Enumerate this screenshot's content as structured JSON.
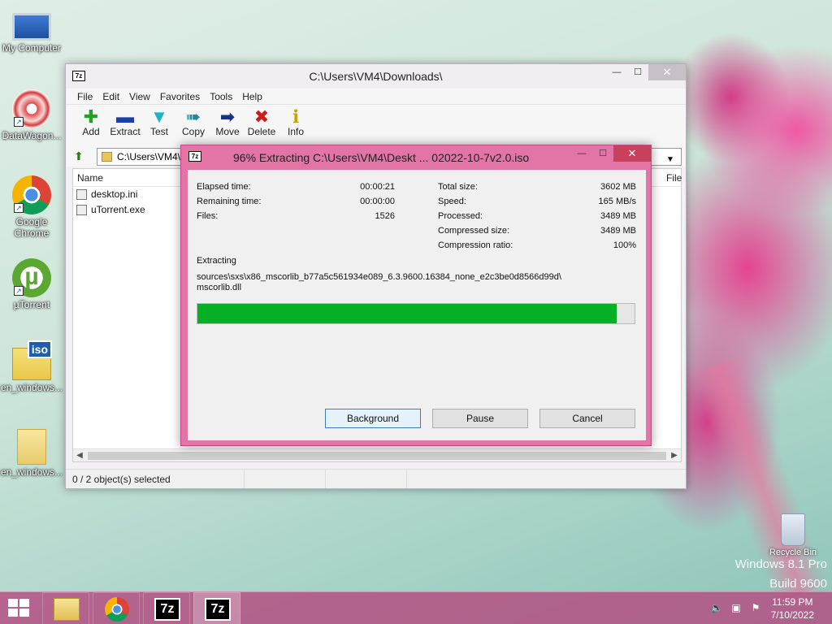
{
  "desktop": {
    "icons": [
      {
        "label": "My Computer"
      },
      {
        "label": "DataWagon..."
      },
      {
        "label": "Google Chrome"
      },
      {
        "label": "µTorrent"
      },
      {
        "label": "en_windows..."
      },
      {
        "label": "en_windows..."
      }
    ],
    "recycle_bin": "Recycle Bin",
    "watermark_line1": "Windows 8.1 Pro",
    "watermark_line2": "Build 9600"
  },
  "main_window": {
    "title": "C:\\Users\\VM4\\Downloads\\",
    "app_icon": "7z",
    "menu": [
      "File",
      "Edit",
      "View",
      "Favorites",
      "Tools",
      "Help"
    ],
    "toolbar": [
      {
        "label": "Add",
        "icon": "plus-icon",
        "color": "#1ea41e"
      },
      {
        "label": "Extract",
        "icon": "minus-icon",
        "color": "#1b3fa8"
      },
      {
        "label": "Test",
        "icon": "check-icon",
        "color": "#20b0c8"
      },
      {
        "label": "Copy",
        "icon": "double-arrow-icon",
        "color": "#1e8a9a"
      },
      {
        "label": "Move",
        "icon": "arrow-right-icon",
        "color": "#1a2f8a"
      },
      {
        "label": "Delete",
        "icon": "x-icon",
        "color": "#d01a1a"
      },
      {
        "label": "Info",
        "icon": "info-icon",
        "color": "#c9a400"
      }
    ],
    "address": "C:\\Users\\VM4\\",
    "columns": {
      "name": "Name",
      "file": "File"
    },
    "files": [
      {
        "name": "desktop.ini"
      },
      {
        "name": "uTorrent.exe"
      }
    ],
    "status": "0 / 2 object(s) selected"
  },
  "progress_dialog": {
    "title": "96% Extracting C:\\Users\\VM4\\Deskt ... 02022-10-7v2.0.iso",
    "app_icon": "7z",
    "left_stats": [
      {
        "label": "Elapsed time:",
        "value": "00:00:21"
      },
      {
        "label": "Remaining time:",
        "value": "00:00:00"
      },
      {
        "label": "Files:",
        "value": "1526"
      }
    ],
    "right_stats": [
      {
        "label": "Total size:",
        "value": "3602 MB"
      },
      {
        "label": "Speed:",
        "value": "165 MB/s"
      },
      {
        "label": "Processed:",
        "value": "3489 MB"
      },
      {
        "label": "Compressed size:",
        "value": "3489 MB"
      },
      {
        "label": "Compression ratio:",
        "value": "100%"
      }
    ],
    "action_label": "Extracting",
    "current_file_line1": "sources\\sxs\\x86_mscorlib_b77a5c561934e089_6.3.9600.16384_none_e2c3be0d8566d99d\\",
    "current_file_line2": "mscorlib.dll",
    "progress_percent": 96,
    "buttons": {
      "background": "Background",
      "pause": "Pause",
      "cancel": "Cancel"
    }
  },
  "taskbar": {
    "time": "11:59 PM",
    "date": "7/10/2022",
    "items": [
      "file-explorer",
      "google-chrome",
      "7-zip",
      "7-zip"
    ]
  }
}
